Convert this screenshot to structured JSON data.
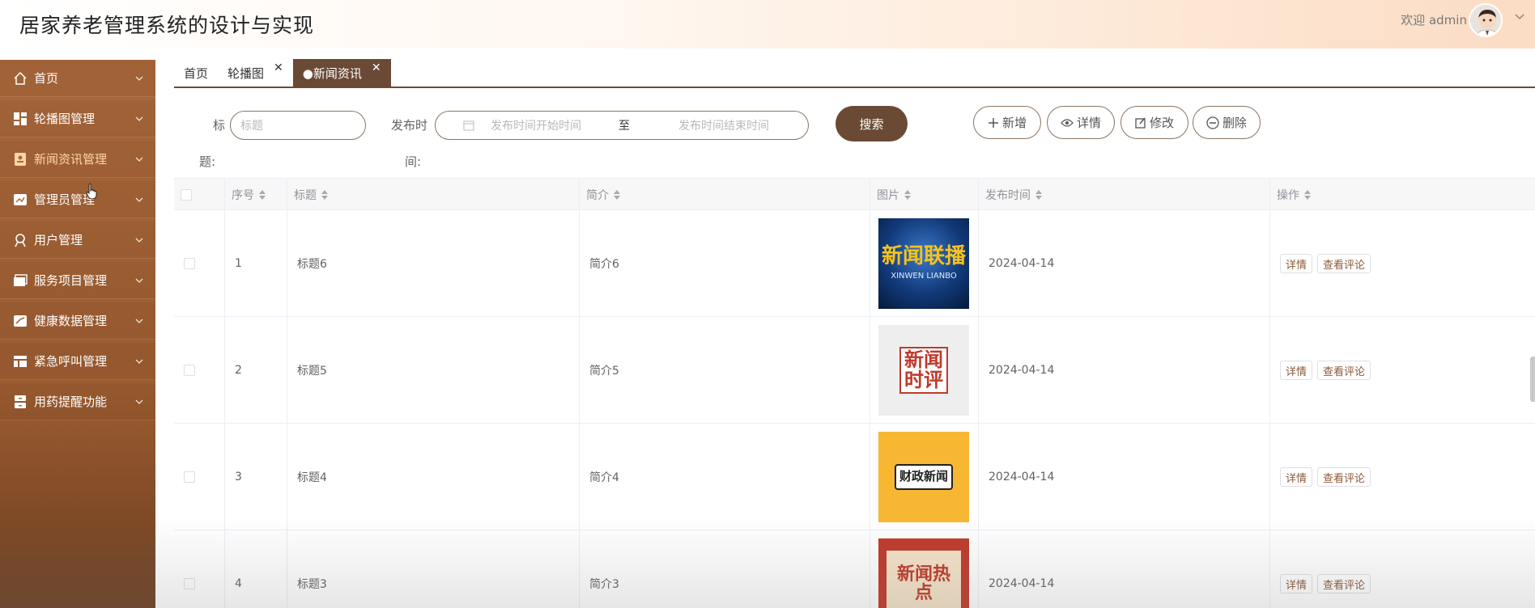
{
  "header": {
    "title": "居家养老管理系统的设计与实现",
    "welcome": "欢迎 admin",
    "avatar_icon": "user-avatar-icon",
    "chevron_icon": "chevron-down-icon"
  },
  "sidebar": {
    "items": [
      {
        "label": "首页",
        "icon": "home-icon"
      },
      {
        "label": "轮播图管理",
        "icon": "dashboard-icon"
      },
      {
        "label": "新闻资讯管理",
        "icon": "news-icon",
        "active": true
      },
      {
        "label": "管理员管理",
        "icon": "admin-icon"
      },
      {
        "label": "用户管理",
        "icon": "user-icon"
      },
      {
        "label": "服务项目管理",
        "icon": "folder-icon"
      },
      {
        "label": "健康数据管理",
        "icon": "health-icon"
      },
      {
        "label": "紧急呼叫管理",
        "icon": "layout-icon"
      },
      {
        "label": "用药提醒功能",
        "icon": "drawer-icon"
      }
    ]
  },
  "tabs": [
    {
      "label": "首页",
      "closable": false
    },
    {
      "label": "轮播图",
      "closable": true
    },
    {
      "label": "●新闻资讯",
      "closable": true,
      "active": true
    }
  ],
  "search": {
    "title_label_1": "标",
    "title_label_2": "题:",
    "title_placeholder": "标题",
    "time_label_1": "发布时",
    "time_label_2": "间:",
    "start_placeholder": "发布时间开始时间",
    "range_sep": "至",
    "end_placeholder": "发布时间结束时间",
    "search_button": "搜索"
  },
  "toolbar": {
    "add": "新增",
    "detail": "详情",
    "edit": "修改",
    "delete": "删除"
  },
  "table": {
    "columns": [
      "序号",
      "标题",
      "简介",
      "图片",
      "发布时间",
      "操作"
    ],
    "rows": [
      {
        "index": "1",
        "title": "标题6",
        "intro": "简介6",
        "image_text": "新闻联播",
        "image_sub": "XINWEN LIANBO",
        "date": "2024-04-14"
      },
      {
        "index": "2",
        "title": "标题5",
        "intro": "简介5",
        "image_text": "新闻时评",
        "image_sub": "",
        "date": "2024-04-14"
      },
      {
        "index": "3",
        "title": "标题4",
        "intro": "简介4",
        "image_text": "财政新闻",
        "image_sub": "",
        "date": "2024-04-14"
      },
      {
        "index": "4",
        "title": "标题3",
        "intro": "简介3",
        "image_text": "新闻热点",
        "image_sub": "",
        "date": "2024-04-14"
      }
    ],
    "row_actions": {
      "detail": "详情",
      "comments": "查看评论"
    }
  },
  "colors": {
    "accent": "#6b4a35",
    "sidebar": "#a9673b",
    "active_menu": "#ffd7a6"
  }
}
